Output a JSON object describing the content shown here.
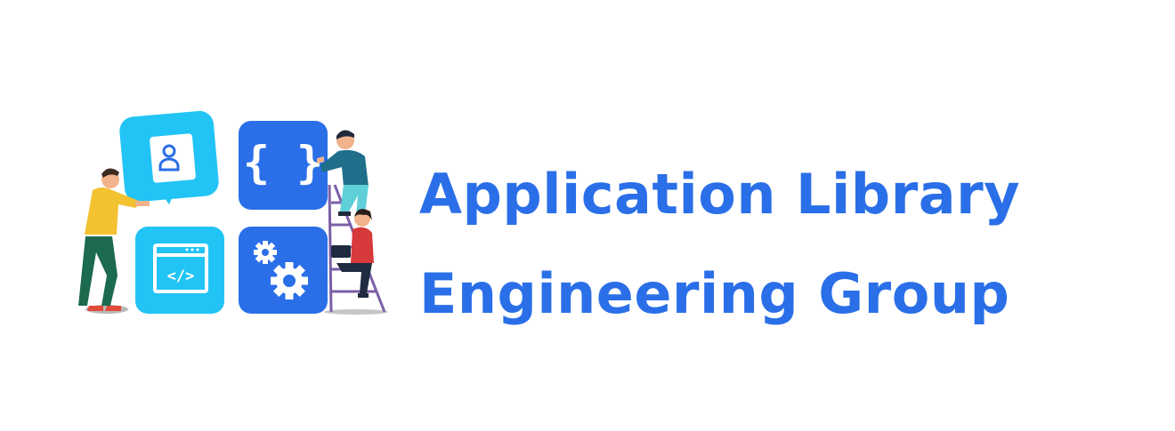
{
  "brand": {
    "line1": "Application Library",
    "line2": "Engineering Group"
  },
  "colors": {
    "brand_blue": "#2a6fe8",
    "tile_light": "#22c4f5",
    "tile_dark": "#2a6fe8",
    "shirt_yellow": "#f2c230",
    "pants_green": "#1d6b4e",
    "shirt_teal": "#1f6f8b",
    "pants_cyan": "#5fd0d8",
    "jacket_red": "#d63a3a",
    "ladder_purple": "#7b5ea7"
  },
  "tiles": {
    "profile": {
      "icon": "user-profile-icon"
    },
    "braces": {
      "icon": "curly-braces-icon",
      "glyph": "{ }"
    },
    "code_window": {
      "icon": "code-window-icon",
      "glyph": "</>"
    },
    "gears": {
      "icon": "gears-icon"
    }
  }
}
